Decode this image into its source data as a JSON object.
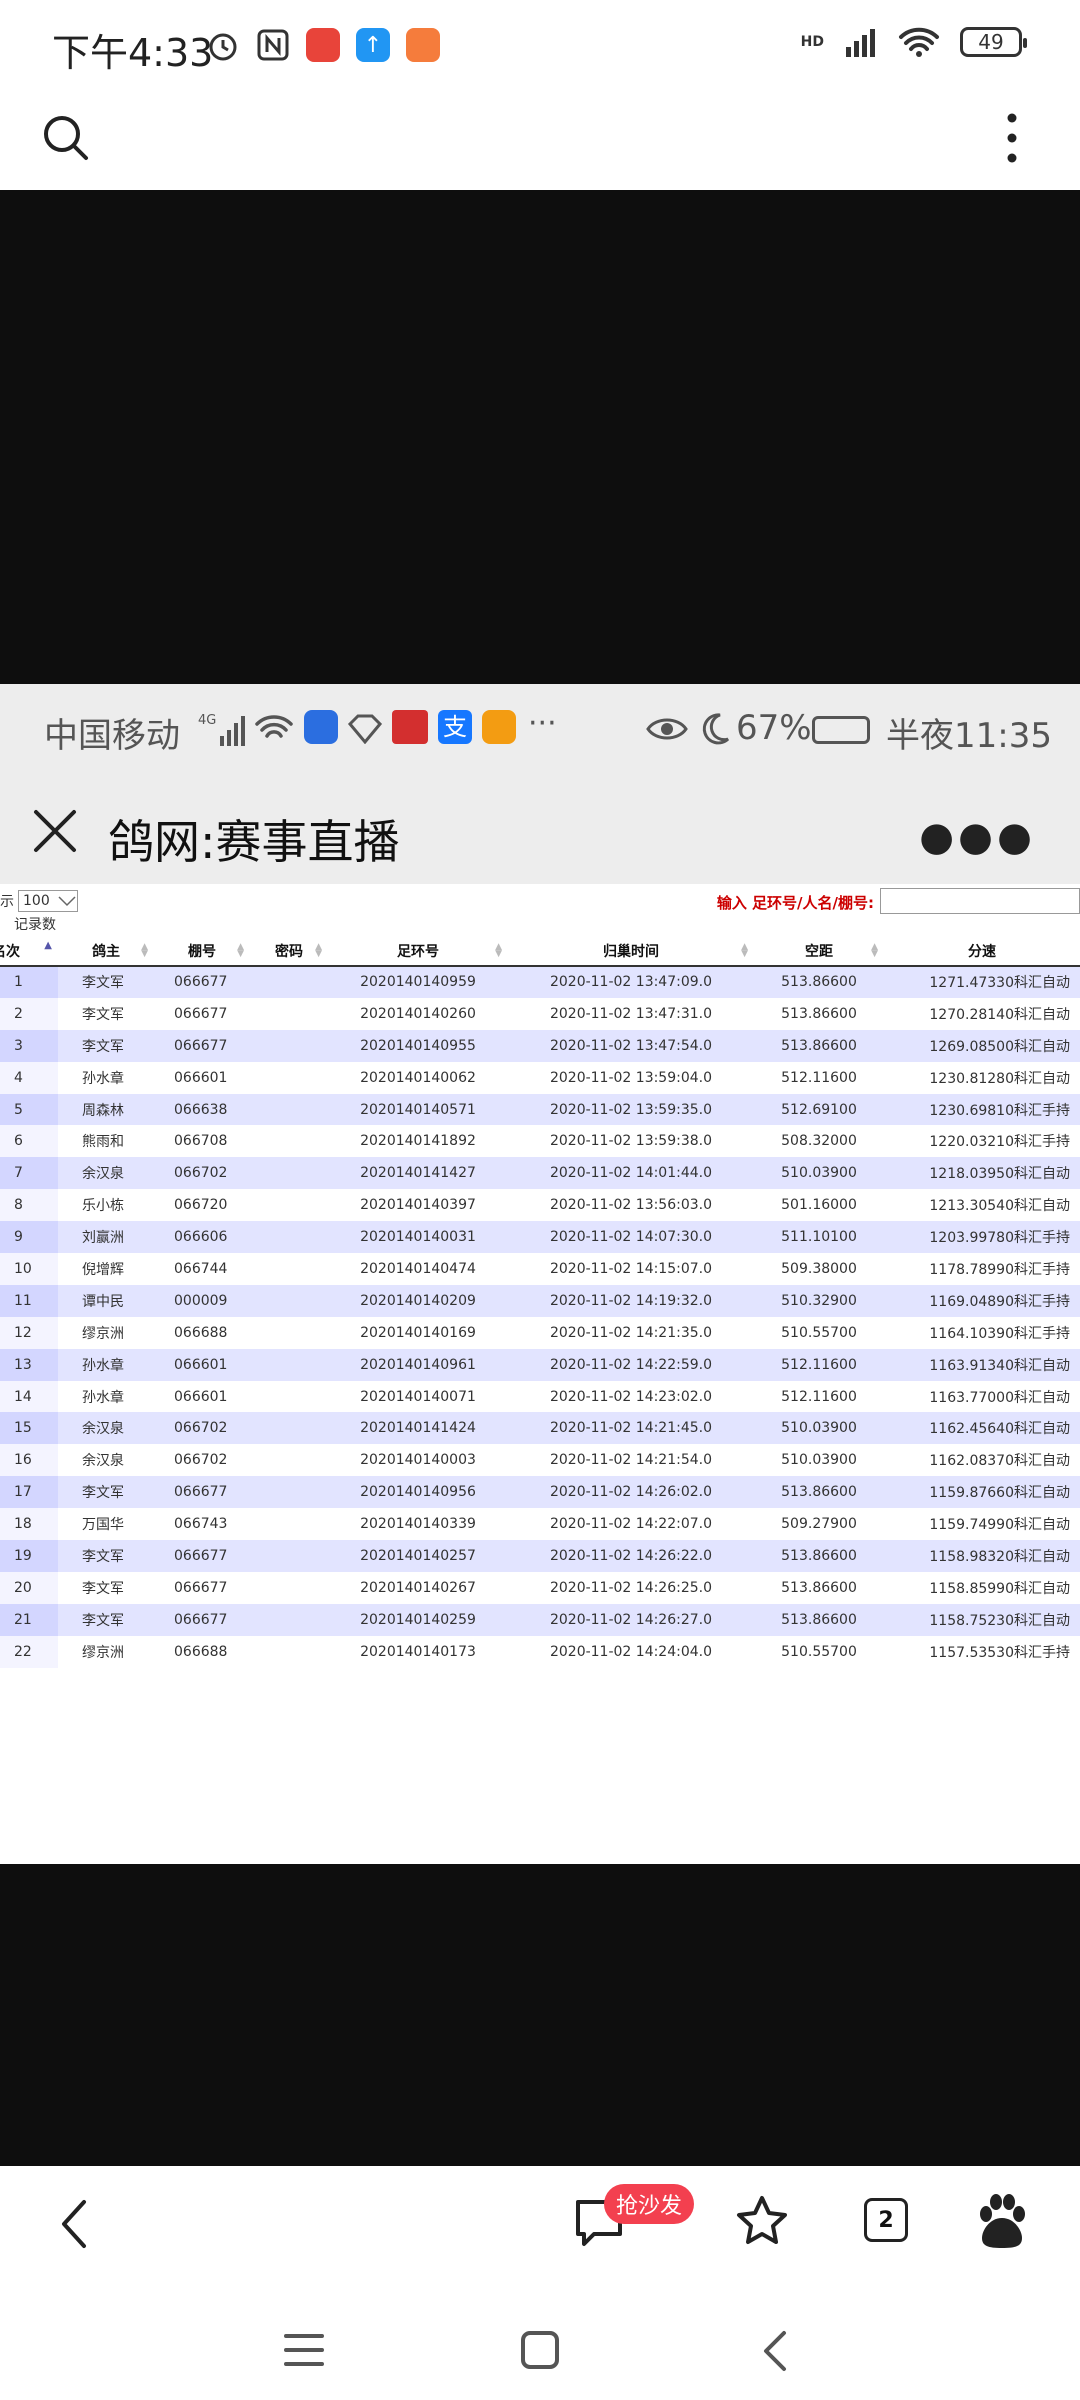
{
  "status_bar": {
    "time": "下午4:33",
    "battery": "49",
    "network": "HD"
  },
  "inner_status": {
    "carrier": "中国移动",
    "battery_pct": "67%",
    "time": "半夜11:35"
  },
  "inner_header": {
    "title": "鸽网:赛事直播"
  },
  "controls": {
    "show_label": "显示",
    "page_size": "100",
    "records_label": "记录数",
    "search_label": "输入 足环号/人名/棚号:"
  },
  "columns": [
    "名次",
    "鸽主",
    "棚号",
    "密码",
    "足环号",
    "归巢时间",
    "空距",
    "分速"
  ],
  "rows": [
    [
      "1",
      "李文军",
      "066677",
      "",
      "2020140140959",
      "2020-11-02 13:47:09.0",
      "513.86600",
      "1271.47330",
      "科汇自动"
    ],
    [
      "2",
      "李文军",
      "066677",
      "",
      "2020140140260",
      "2020-11-02 13:47:31.0",
      "513.86600",
      "1270.28140",
      "科汇自动"
    ],
    [
      "3",
      "李文军",
      "066677",
      "",
      "2020140140955",
      "2020-11-02 13:47:54.0",
      "513.86600",
      "1269.08500",
      "科汇自动"
    ],
    [
      "4",
      "孙水章",
      "066601",
      "",
      "2020140140062",
      "2020-11-02 13:59:04.0",
      "512.11600",
      "1230.81280",
      "科汇自动"
    ],
    [
      "5",
      "周森林",
      "066638",
      "",
      "2020140140571",
      "2020-11-02 13:59:35.0",
      "512.69100",
      "1230.69810",
      "科汇手持"
    ],
    [
      "6",
      "熊雨和",
      "066708",
      "",
      "2020140141892",
      "2020-11-02 13:59:38.0",
      "508.32000",
      "1220.03210",
      "科汇手持"
    ],
    [
      "7",
      "余汉泉",
      "066702",
      "",
      "2020140141427",
      "2020-11-02 14:01:44.0",
      "510.03900",
      "1218.03950",
      "科汇自动"
    ],
    [
      "8",
      "乐小栋",
      "066720",
      "",
      "2020140140397",
      "2020-11-02 13:56:03.0",
      "501.16000",
      "1213.30540",
      "科汇自动"
    ],
    [
      "9",
      "刘赢洲",
      "066606",
      "",
      "2020140140031",
      "2020-11-02 14:07:30.0",
      "511.10100",
      "1203.99780",
      "科汇手持"
    ],
    [
      "10",
      "倪增辉",
      "066744",
      "",
      "2020140140474",
      "2020-11-02 14:15:07.0",
      "509.38000",
      "1178.78990",
      "科汇手持"
    ],
    [
      "11",
      "谭中民",
      "000009",
      "",
      "2020140140209",
      "2020-11-02 14:19:32.0",
      "510.32900",
      "1169.04890",
      "科汇手持"
    ],
    [
      "12",
      "缪京洲",
      "066688",
      "",
      "2020140140169",
      "2020-11-02 14:21:35.0",
      "510.55700",
      "1164.10390",
      "科汇手持"
    ],
    [
      "13",
      "孙水章",
      "066601",
      "",
      "2020140140961",
      "2020-11-02 14:22:59.0",
      "512.11600",
      "1163.91340",
      "科汇自动"
    ],
    [
      "14",
      "孙水章",
      "066601",
      "",
      "2020140140071",
      "2020-11-02 14:23:02.0",
      "512.11600",
      "1163.77000",
      "科汇自动"
    ],
    [
      "15",
      "余汉泉",
      "066702",
      "",
      "2020140141424",
      "2020-11-02 14:21:45.0",
      "510.03900",
      "1162.45640",
      "科汇自动"
    ],
    [
      "16",
      "余汉泉",
      "066702",
      "",
      "2020140140003",
      "2020-11-02 14:21:54.0",
      "510.03900",
      "1162.08370",
      "科汇自动"
    ],
    [
      "17",
      "李文军",
      "066677",
      "",
      "2020140140956",
      "2020-11-02 14:26:02.0",
      "513.86600",
      "1159.87660",
      "科汇自动"
    ],
    [
      "18",
      "万国华",
      "066743",
      "",
      "2020140140339",
      "2020-11-02 14:22:07.0",
      "509.27900",
      "1159.74990",
      "科汇自动"
    ],
    [
      "19",
      "李文军",
      "066677",
      "",
      "2020140140257",
      "2020-11-02 14:26:22.0",
      "513.86600",
      "1158.98320",
      "科汇自动"
    ],
    [
      "20",
      "李文军",
      "066677",
      "",
      "2020140140267",
      "2020-11-02 14:26:25.0",
      "513.86600",
      "1158.85990",
      "科汇自动"
    ],
    [
      "21",
      "李文军",
      "066677",
      "",
      "2020140140259",
      "2020-11-02 14:26:27.0",
      "513.86600",
      "1158.75230",
      "科汇自动"
    ],
    [
      "22",
      "缪京洲",
      "066688",
      "",
      "2020140140173",
      "2020-11-02 14:24:04.0",
      "510.55700",
      "1157.53530",
      "科汇手持"
    ]
  ],
  "bottom_nav": {
    "badge": "抢沙发",
    "tab_count": "2"
  },
  "icons": [
    "search-icon",
    "more-vert-icon",
    "back-icon",
    "comment-icon",
    "star-icon",
    "baidu-paw-icon",
    "menu-icon",
    "home-icon"
  ],
  "colors": {
    "row_odd": "#e2e4ff",
    "badge": "#f3404f",
    "search_label": "#cc0000"
  }
}
